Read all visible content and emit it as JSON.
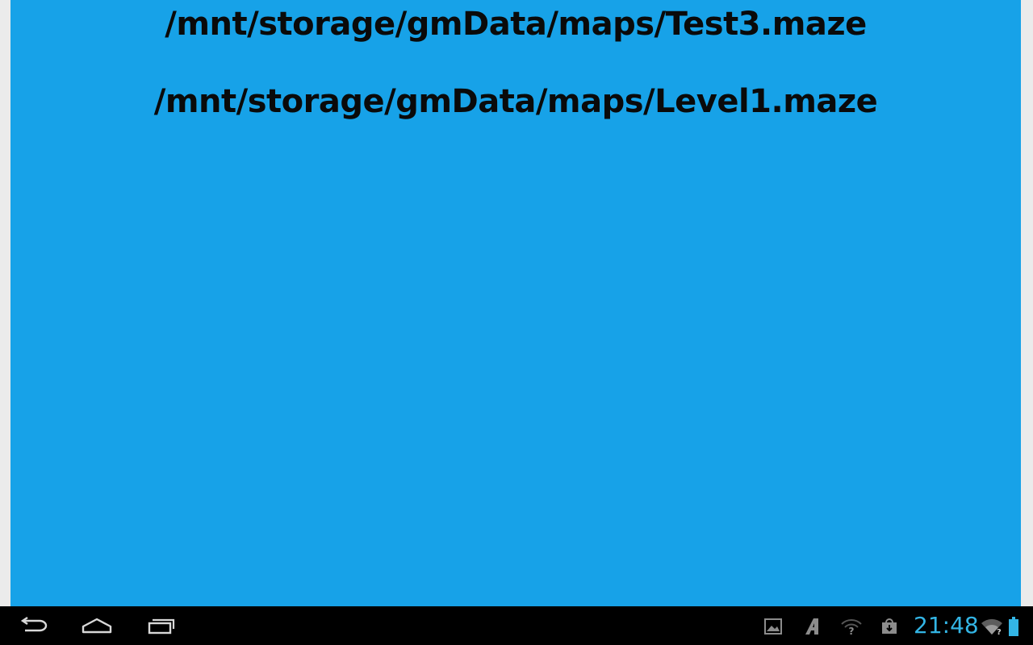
{
  "files": [
    {
      "path": "/mnt/storage/gmData/maps/Test3.maze"
    },
    {
      "path": "/mnt/storage/gmData/maps/Level1.maze"
    }
  ],
  "status_bar": {
    "time": "21:48",
    "icons": [
      "gallery-icon",
      "font-icon",
      "wifi-question-icon",
      "store-download-icon",
      "wifi-icon",
      "battery-icon"
    ]
  },
  "navigation_bar": {
    "buttons": [
      "back-icon",
      "home-icon",
      "recent-apps-icon"
    ]
  },
  "colors": {
    "content_background": "#17a2e8",
    "text": "#0a0a0a",
    "navbar_background": "#000000",
    "clock": "#33b5e5",
    "icon_gray": "#8c8c8c"
  }
}
